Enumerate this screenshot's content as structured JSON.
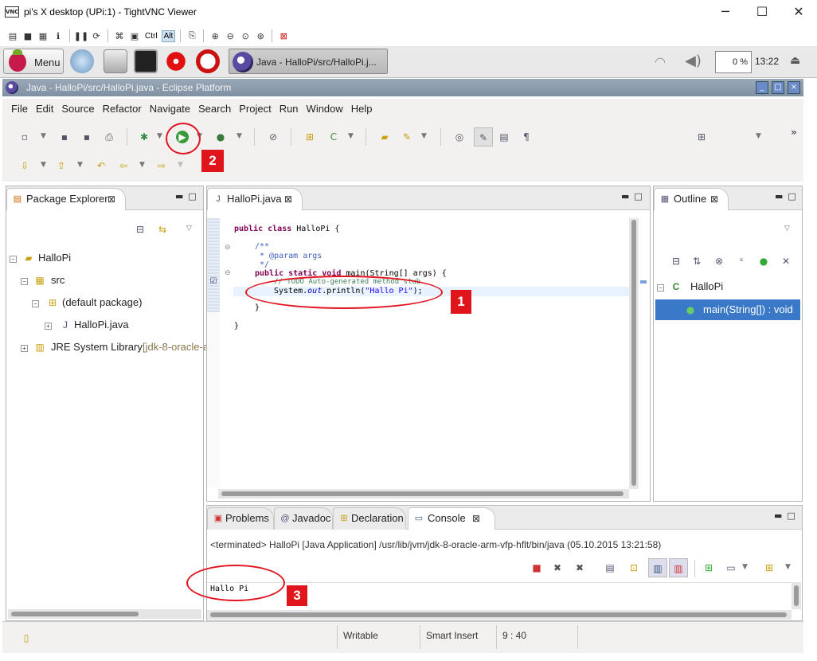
{
  "vnc_window": {
    "title": "pi's X desktop (UPi:1) - TightVNC Viewer",
    "logo_text": "VNC",
    "minimize": "─",
    "maximize": "☐",
    "close": "✕",
    "toolbar": {
      "ctrl_label": "Ctrl",
      "alt_label": "Alt"
    }
  },
  "taskbar": {
    "menu_label": "Menu",
    "task_label": "Java - HalloPi/src/HalloPi.j...",
    "cpu": "0 %",
    "clock": "13:22"
  },
  "eclipse": {
    "title": "Java - HalloPi/src/HalloPi.java - Eclipse Platform",
    "menu": [
      "File",
      "Edit",
      "Source",
      "Refactor",
      "Navigate",
      "Search",
      "Project",
      "Run",
      "Window",
      "Help"
    ],
    "package_explorer": {
      "tab_label": "Package Explorer",
      "tree": [
        {
          "label": "HalloPi",
          "icon": "project-icon"
        },
        {
          "label": "src",
          "icon": "source-folder-icon"
        },
        {
          "label": "(default package)",
          "icon": "package-icon"
        },
        {
          "label": "HalloPi.java",
          "icon": "java-file-icon"
        },
        {
          "label": "JRE System Library",
          "suffix": "[jdk-8-oracle-a",
          "icon": "library-icon"
        }
      ]
    },
    "editor": {
      "tab_label": "HalloPi.java",
      "code": {
        "line1_kw": "public class",
        "line1_rest": " HalloPi {",
        "doc1": "/**",
        "doc2": " * @param args",
        "doc3": " */",
        "line_main_kw": "public static void",
        "line_main_rest": " main(String[] args) {",
        "todo": "// TODO Auto-generated method stub",
        "print_a": "System.",
        "print_out": "out",
        "print_b": ".println(",
        "print_str": "\"Hallo Pi\"",
        "print_c": ");",
        "close1": "}",
        "close2": "}"
      }
    },
    "outline": {
      "tab_label": "Outline",
      "class_label": "HalloPi",
      "method_label": "main(String[]) : void"
    },
    "bottom": {
      "tabs": [
        "Problems",
        "Javadoc",
        "Declaration",
        "Console"
      ],
      "terminated_line": "<terminated> HalloPi [Java Application] /usr/lib/jvm/jdk-8-oracle-arm-vfp-hflt/bin/java (05.10.2015 13:21:58)",
      "console_output": "Hallo Pi"
    },
    "status": {
      "writable": "Writable",
      "insert_mode": "Smart Insert",
      "position": "9 : 40"
    }
  },
  "annotations": {
    "label1": "1",
    "label2": "2",
    "label3": "3",
    "color": "#e0151b"
  }
}
